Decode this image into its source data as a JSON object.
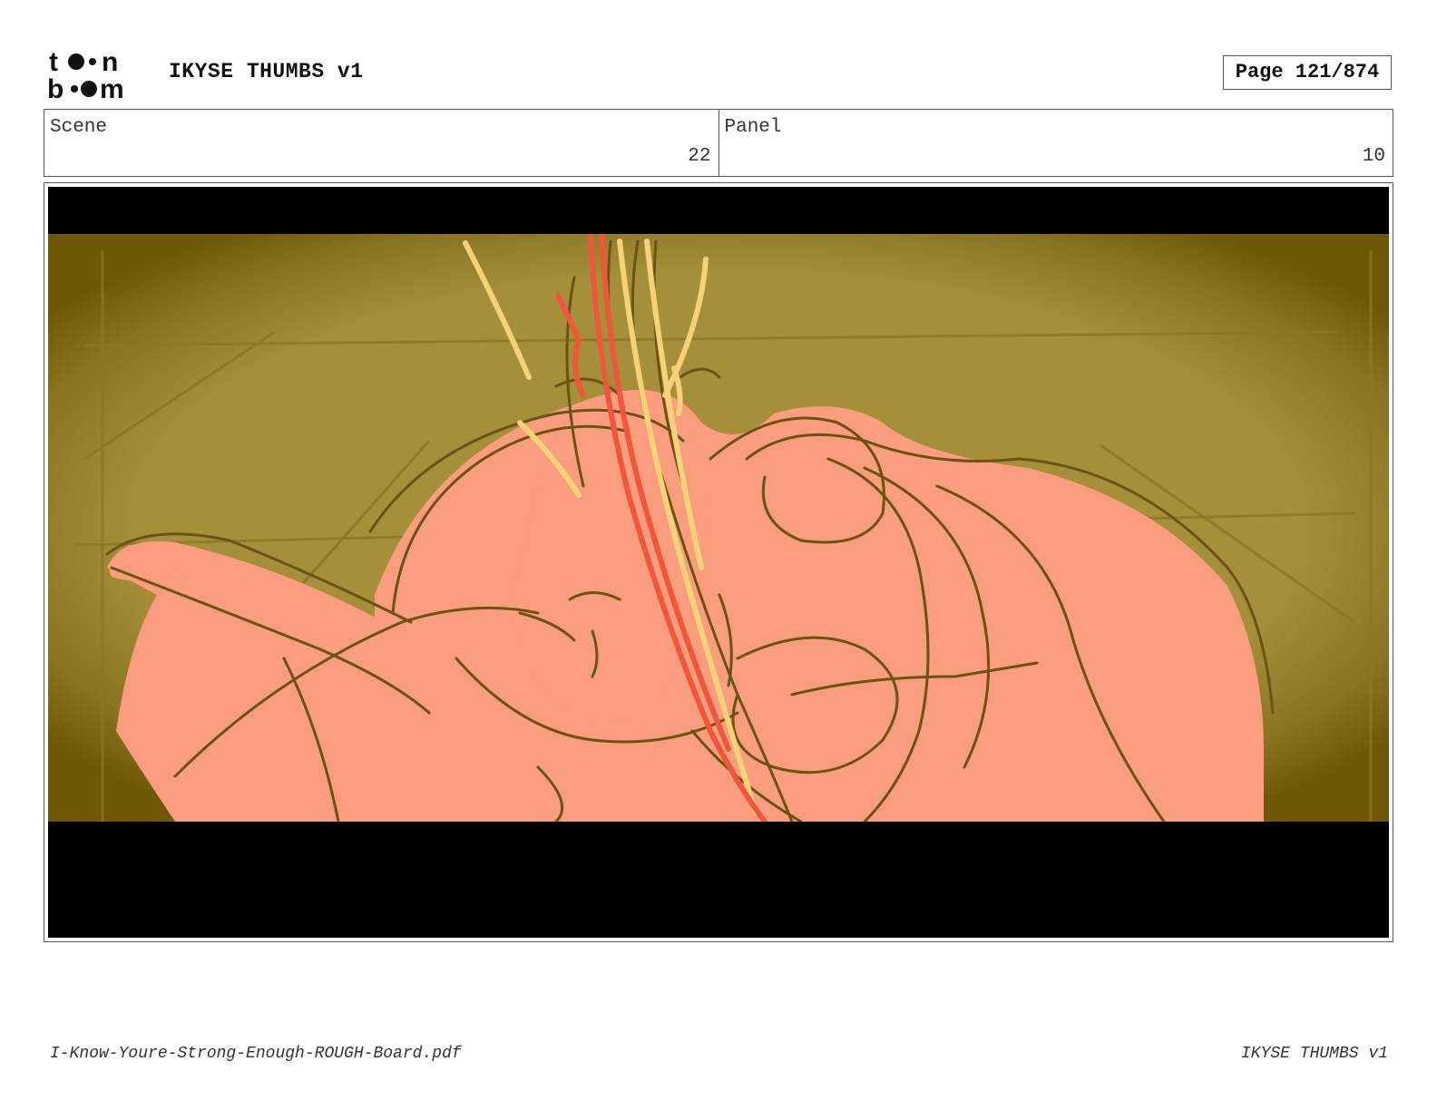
{
  "header": {
    "logo_text": "toon boom",
    "title": "IKYSE THUMBS v1",
    "page_label": "Page 121/874"
  },
  "info": {
    "scene_label": "Scene",
    "scene_value": "22",
    "panel_label": "Panel",
    "panel_value": "10"
  },
  "panel": {
    "image_description_icon": "storyboard-sketch",
    "colors": {
      "background": "#a58f3a",
      "vignette": "#6e5705",
      "skin": "#fa9d7c",
      "line": "#6b5312",
      "highlight": "#f3d27a",
      "accent": "#f0563c"
    }
  },
  "footer": {
    "filename": "I-Know-Youre-Strong-Enough-ROUGH-Board.pdf",
    "title": "IKYSE THUMBS v1"
  }
}
